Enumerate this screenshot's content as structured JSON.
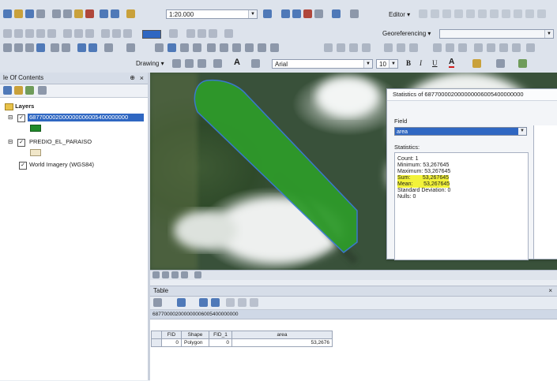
{
  "toolbar": {
    "scale": "1:20.000",
    "editor_label": "Editor",
    "georef_label": "Georeferencing",
    "drawing_label": "Drawing",
    "font_name": "Arial",
    "font_size": "10",
    "bold": "B",
    "italic": "I",
    "underline": "U",
    "font_color": "A"
  },
  "toc": {
    "title": "le Of Contents",
    "pin": "⊕",
    "close": "×",
    "layers_label": "Layers",
    "items": [
      {
        "name": "687700002000000006005400000000",
        "checked": true,
        "selected": true
      },
      {
        "name": "PREDIO_EL_PARAISO",
        "checked": true,
        "selected": false
      },
      {
        "name": "World Imagery (WGS84)",
        "checked": true,
        "selected": false
      }
    ],
    "swatch_color": "#1f8a2a",
    "swatch2_color": "#f1e7c9"
  },
  "stats": {
    "title": "Statistics of 687700002000000006005400000000",
    "field_label": "Field",
    "field_value": "area",
    "statistics_label": "Statistics:",
    "lines": [
      {
        "label": "Count:",
        "value": "1",
        "highlight": false
      },
      {
        "label": "Minimum:",
        "value": "53,267645",
        "highlight": false
      },
      {
        "label": "Maximum:",
        "value": "53,267645",
        "highlight": false
      },
      {
        "label": "Sum:",
        "value": "53,267645",
        "highlight": true
      },
      {
        "label": "Mean:",
        "value": "53,267645",
        "highlight": true
      },
      {
        "label": "Standard Deviation:",
        "value": "0",
        "highlight": false
      },
      {
        "label": "Nulls:",
        "value": "0",
        "highlight": false
      }
    ]
  },
  "table": {
    "title": "Table",
    "close": "×",
    "layer_name": "687700002000000006005400000000",
    "columns": [
      "FID",
      "Shape",
      "FID_1",
      "area"
    ],
    "rows": [
      {
        "fid": "0",
        "shape": "Polygon",
        "fid1": "0",
        "area": "53,2676"
      }
    ]
  },
  "colors": {
    "polygon_fill": "#2e9a2a",
    "polygon_stroke": "#3a7bd5",
    "selection": "#2f67c2",
    "highlight": "#f2f23a"
  }
}
